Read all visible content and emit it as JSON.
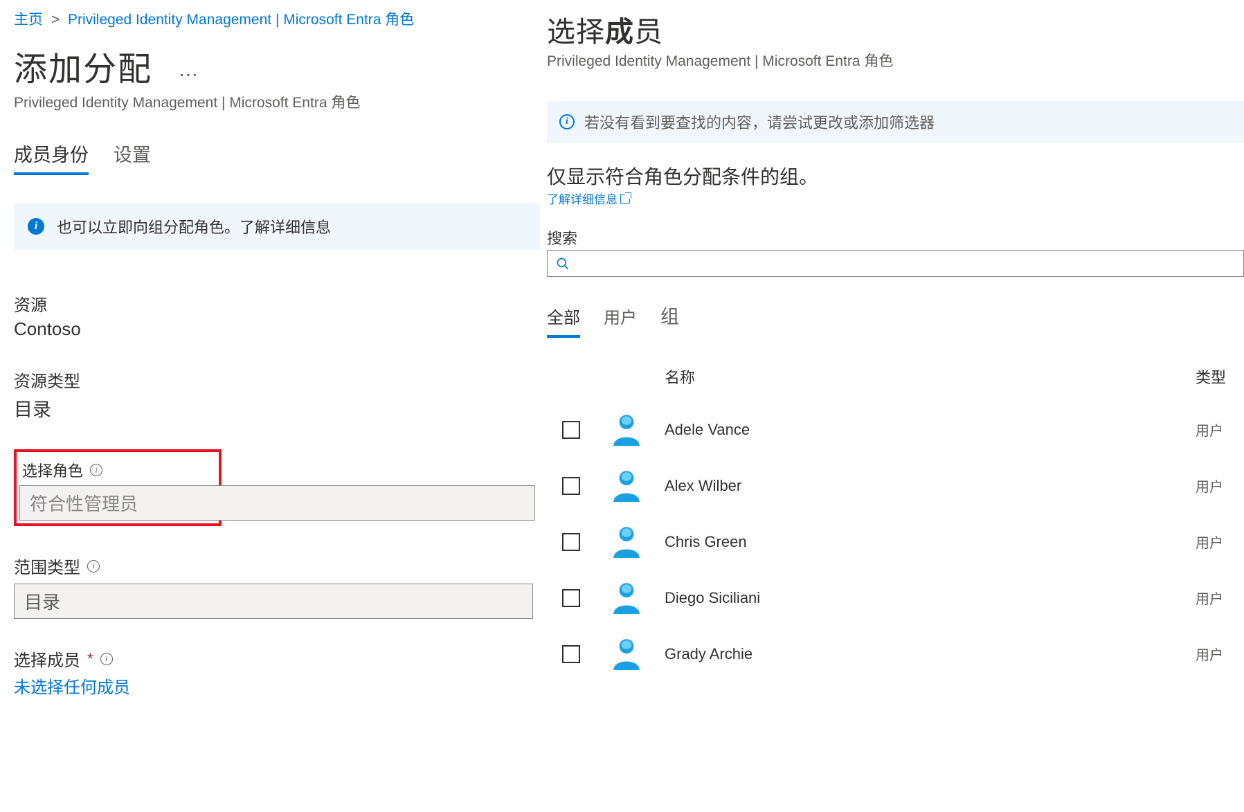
{
  "breadcrumb": {
    "home": "主页",
    "current": "Privileged Identity Management | Microsoft Entra 角色"
  },
  "left": {
    "title": "添加分配",
    "subtitle": "Privileged Identity Management | Microsoft Entra 角色",
    "tabs": {
      "membership": "成员身份",
      "settings": "设置"
    },
    "infobanner": "也可以立即向组分配角色。了解详细信息",
    "resource_label": "资源",
    "resource_value": "Contoso",
    "resource_type_label": "资源类型",
    "resource_type_value": "目录",
    "select_role_label": "选择角色",
    "select_role_value": "符合性管理员",
    "scope_type_label": "范围类型",
    "scope_type_value": "目录",
    "select_member_label": "选择成员",
    "no_member_selected": "未选择任何成员"
  },
  "right": {
    "title_prefix": "选择",
    "title_bold": "成",
    "title_suffix": "员",
    "subtitle": "Privileged Identity Management | Microsoft Entra 角色",
    "infobanner": "若没有看到要查找的内容，请尝试更改或添加筛选器",
    "eligible_text": "仅显示符合角色分配条件的组。",
    "learn_more": "了解详细信息",
    "search_label": "搜索",
    "search_placeholder": "",
    "filter_tabs": {
      "all": "全部",
      "users": "用户",
      "groups": "组"
    },
    "col_name": "名称",
    "col_type": "类型",
    "members": [
      {
        "name": "Adele Vance",
        "type": "用户"
      },
      {
        "name": "Alex Wilber",
        "type": "用户"
      },
      {
        "name": "Chris Green",
        "type": "用户"
      },
      {
        "name": "Diego Siciliani",
        "type": "用户"
      },
      {
        "name": "Grady Archie",
        "type": "用户"
      }
    ]
  }
}
